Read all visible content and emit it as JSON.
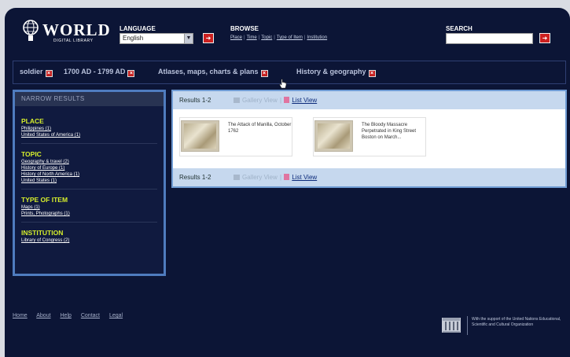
{
  "header": {
    "logo": {
      "word": "WORLD",
      "sub": "DIGITAL LIBRARY"
    },
    "language": {
      "label": "LANGUAGE",
      "selected": "English"
    },
    "browse": {
      "label": "BROWSE",
      "links": [
        "Place",
        "Time",
        "Topic",
        "Type of Item",
        "Institution"
      ]
    },
    "search": {
      "label": "SEARCH",
      "value": ""
    },
    "go_glyph": "➜"
  },
  "filters": [
    {
      "label": "soldier"
    },
    {
      "label": "1700 AD - 1799 AD"
    },
    {
      "label": "Atlases, maps, charts & plans"
    },
    {
      "label": "History & geography"
    }
  ],
  "narrow": {
    "title": "NARROW RESULTS",
    "facets": [
      {
        "title": "PLACE",
        "items": [
          "Philippines (1)",
          "United States of America (1)"
        ]
      },
      {
        "title": "TOPIC",
        "items": [
          "Geography & travel (2)",
          "History of Europe (1)",
          "History of North America (1)",
          "United States (1)"
        ]
      },
      {
        "title": "TYPE OF ITEM",
        "items": [
          "Maps (1)",
          "Prints, Photographs (1)"
        ]
      },
      {
        "title": "INSTITUTION",
        "items": [
          "Library of Congress (2)"
        ]
      }
    ]
  },
  "results": {
    "count": "Results 1-2",
    "gallery_view": "Gallery View",
    "separator": "|",
    "list_view": "List View",
    "items": [
      {
        "title": "The Attack of Manilla, October 1762"
      },
      {
        "title": "The Bloody Massacre Perpetrated in King Street Boston on March..."
      }
    ]
  },
  "footer": {
    "links": [
      "Home",
      "About",
      "Help",
      "Contact",
      "Legal"
    ],
    "unesco_text": "With the support of the United Nations Educational, Scientific and Cultural Organization"
  },
  "colors": {
    "background": "#0c1536",
    "accent_red": "#cc2020",
    "facet_title": "#d6ee2c",
    "panel_border": "#4f7cbf"
  }
}
